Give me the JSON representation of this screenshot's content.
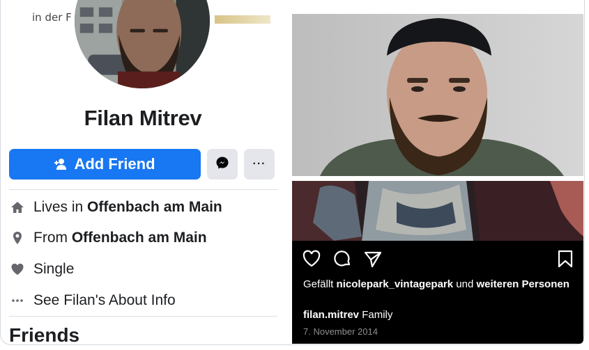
{
  "facebook": {
    "top_text": "in der F",
    "name": "Filan Mitrev",
    "add_friend_label": "Add Friend",
    "more_label": "···",
    "info": [
      {
        "icon": "home-icon",
        "prefix": "Lives in ",
        "value": "Offenbach am Main"
      },
      {
        "icon": "location-pin-icon",
        "prefix": "From ",
        "value": "Offenbach am Main"
      },
      {
        "icon": "heart-icon",
        "prefix": "",
        "value": "Single"
      },
      {
        "icon": "more-dots-icon",
        "prefix": "",
        "value": "See Filan's About Info"
      }
    ],
    "friends_heading": "Friends",
    "accent": "#1877f2"
  },
  "instagram": {
    "likes_prefix": "Gefällt ",
    "likes_user": "nicolepark_vintagepark",
    "likes_middle": " und ",
    "likes_rest": "weiteren Personen",
    "caption_user": "filan.mitrev",
    "caption_text": " Family",
    "date": "7. November 2014",
    "icons": [
      "heart-outline-icon",
      "comment-icon",
      "share-icon",
      "bookmark-icon"
    ]
  }
}
